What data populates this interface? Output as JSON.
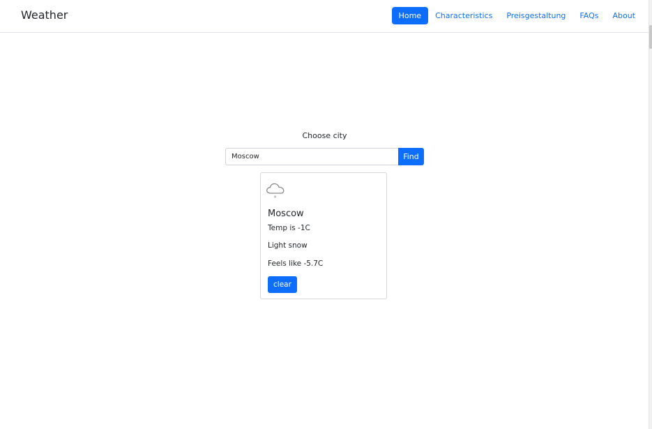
{
  "navbar": {
    "brand": "Weather",
    "items": [
      {
        "label": "Home",
        "active": true
      },
      {
        "label": "Characteristics",
        "active": false
      },
      {
        "label": "Preisgestaltung",
        "active": false
      },
      {
        "label": "FAQs",
        "active": false
      },
      {
        "label": "About",
        "active": false
      }
    ]
  },
  "search": {
    "label": "Choose city",
    "value": "Moscow",
    "button_label": "Find"
  },
  "card": {
    "icon": "cloud-snow-icon",
    "city": "Moscow",
    "temp": "Temp is -1C",
    "condition": "Light snow",
    "feels_like": "Feels like -5.7C",
    "clear_label": "clear"
  },
  "colors": {
    "accent": "#0d6efd",
    "border": "#dee2e6"
  }
}
